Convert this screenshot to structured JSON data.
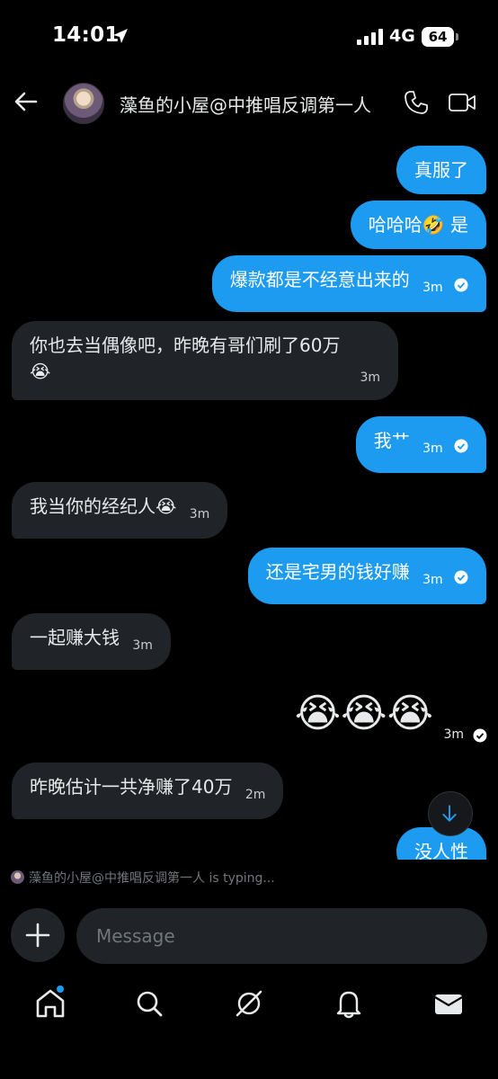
{
  "status": {
    "time": "14:01",
    "network": "4G",
    "battery": "64"
  },
  "header": {
    "title": "藻鱼的小屋@中推唱反调第一人"
  },
  "messages": [
    {
      "side": "out",
      "text": "真服了"
    },
    {
      "side": "out",
      "text": "哈哈哈🤣 是"
    },
    {
      "side": "out",
      "text": "爆款都是不经意出来的",
      "time": "3m",
      "read": true
    },
    {
      "side": "in",
      "text": "你也去当偶像吧，昨晚有哥们刷了60万",
      "emoji": "😭",
      "time": "3m"
    },
    {
      "side": "out",
      "text": "我艹",
      "time": "3m",
      "read": true
    },
    {
      "side": "in",
      "text": "我当你的经纪人",
      "emoji": "😭",
      "time": "3m"
    },
    {
      "side": "out",
      "text": "还是宅男的钱好赚",
      "time": "3m",
      "read": true
    },
    {
      "side": "in",
      "text": "一起赚大钱",
      "time": "3m"
    },
    {
      "side": "out",
      "text": "😭😭😭",
      "time": "3m",
      "read": true
    },
    {
      "side": "in",
      "text": "昨晚估计一共净赚了40万",
      "time": "2m"
    },
    {
      "side": "out",
      "text": "没人性"
    }
  ],
  "typing": {
    "text": "藻鱼的小屋@中推唱反调第一人 is typing..."
  },
  "composer": {
    "placeholder": "Message"
  },
  "nav": {
    "items": [
      "home-icon",
      "search-icon",
      "grok-icon",
      "notifications-icon",
      "messages-icon"
    ]
  },
  "colors": {
    "accent": "#1d9bf0",
    "bubble_in": "#202327",
    "background": "#000000"
  }
}
